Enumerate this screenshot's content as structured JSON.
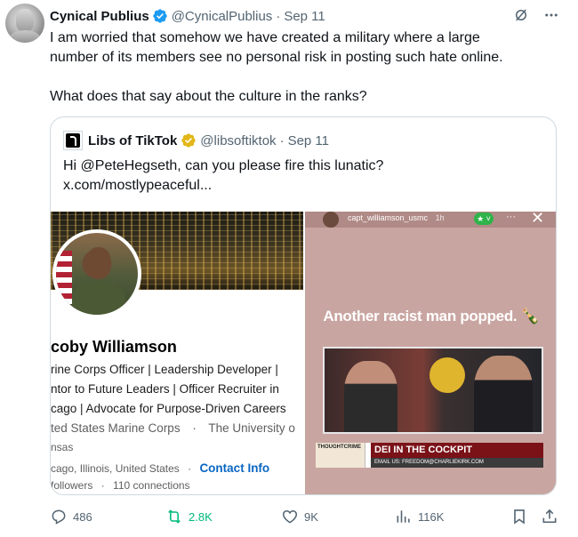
{
  "tweet": {
    "author": {
      "display_name": "Cynical Publius",
      "handle": "@CynicalPublius",
      "date": "Sep 11",
      "separator": "·"
    },
    "text_lines": [
      "I am worried that somehow we have created a military where a large",
      "number of its members see no personal risk in posting such hate online.",
      "What does that say about the culture in the ranks?"
    ],
    "top_icons": [
      "grok-icon",
      "more-icon"
    ]
  },
  "quote": {
    "author": {
      "display_name": "Libs of TikTok",
      "handle": "@libsoftiktok",
      "date": "Sep 11",
      "separator": "·"
    },
    "text_lines": [
      "Hi @PeteHegseth, can you please fire this lunatic?",
      "x.com/mostlypeaceful..."
    ],
    "media_left": {
      "name": "coby Williamson",
      "lines": [
        "rine Corps Officer | Leadership Developer |",
        "ntor to Future Leaders | Officer Recruiter in",
        "cago | Advocate for Purpose-Driven Careers"
      ],
      "org_line": "ted States Marine Corps",
      "org_sep": "·",
      "org_line2": "The University o",
      "location_frag": "nsas",
      "location": "cago, Illinois, United States",
      "location_sep": "·",
      "contact": "Contact Info",
      "followers": "followers",
      "conn_sep": "·",
      "connections": "110 connections"
    },
    "media_right": {
      "username": "capt_williamson_usmc",
      "time": "1h",
      "star": "★ ˅",
      "dots": "···",
      "close": "✕",
      "caption": "Another racist man popped. 🍾",
      "logo_text": "THOUGHTCRIME",
      "banner_title": "DEI IN THE COCKPIT",
      "banner_sub": "EMAIL US: FREEDOM@CHARLIEKIRK.COM"
    }
  },
  "actions": {
    "replies": "486",
    "reposts": "2.8K",
    "likes": "9K",
    "views": "116K"
  },
  "colors": {
    "text": "#0f1419",
    "secondary": "#536471",
    "verified_blue": "#1d9bf0",
    "verified_gold": "#e2b719",
    "repost_green": "#00ba7c",
    "border": "#cfd9de"
  }
}
